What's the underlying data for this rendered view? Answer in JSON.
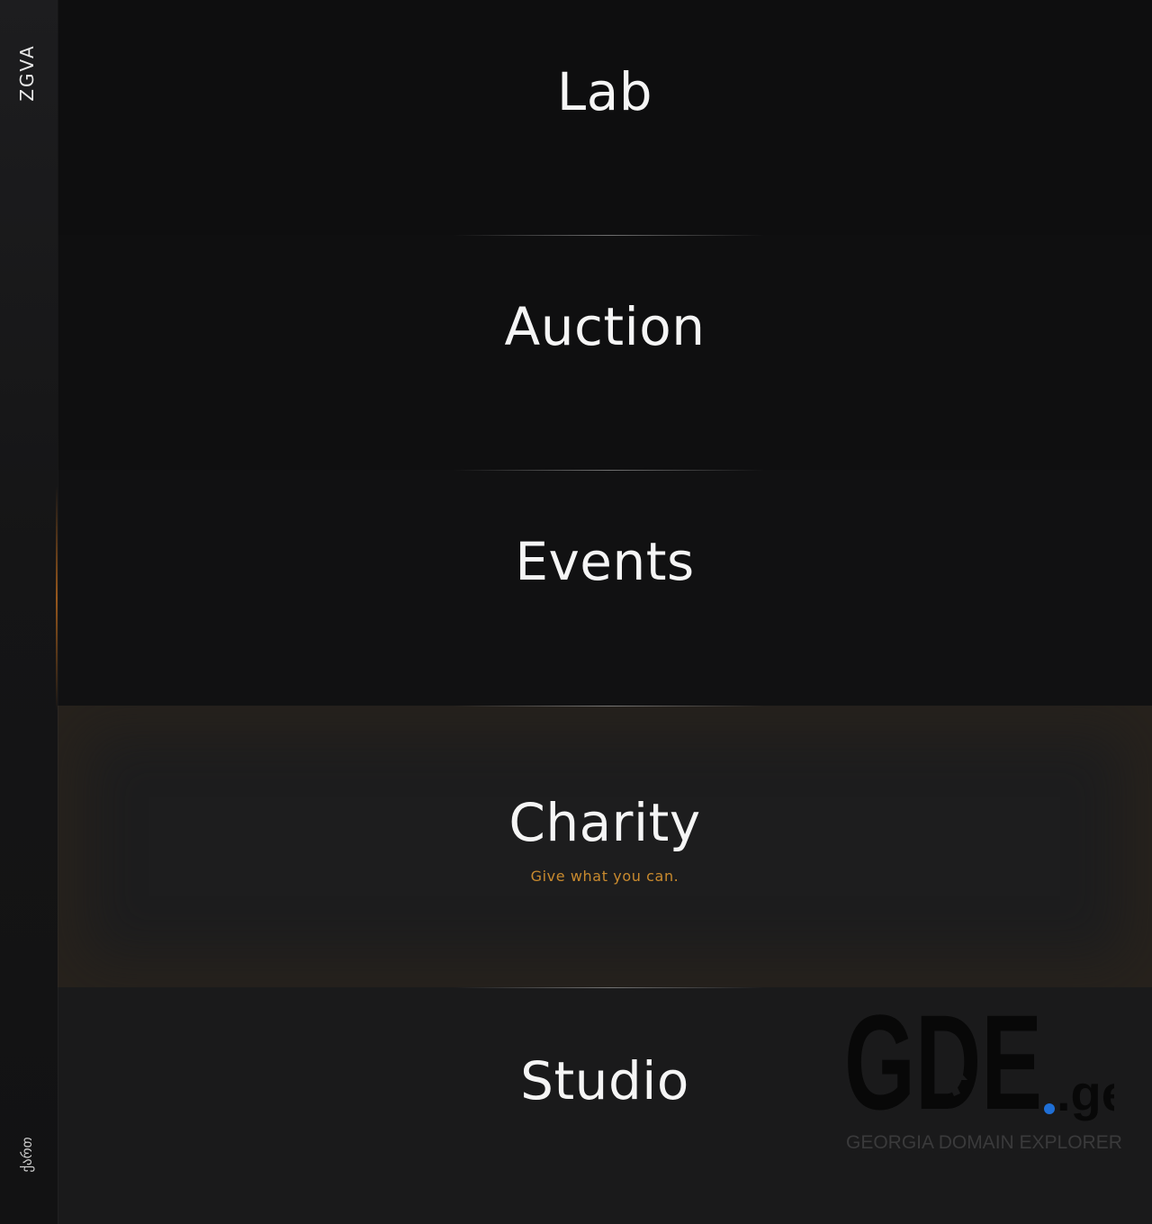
{
  "sidebar": {
    "brand": "ZGVA",
    "lang": "ქართ"
  },
  "sections": [
    {
      "title": "Lab",
      "subtitle": ""
    },
    {
      "title": "Auction",
      "subtitle": ""
    },
    {
      "title": "Events",
      "subtitle": ""
    },
    {
      "title": "Charity",
      "subtitle": "Give what you can."
    },
    {
      "title": "Studio",
      "subtitle": ""
    }
  ],
  "active_section": "Charity",
  "watermark": {
    "logo_text": "GDE",
    "logo_suffix": ".ge",
    "caption": "GEORGIA DOMAIN EXPLORER"
  },
  "colors": {
    "accent": "#c98a2e",
    "background": "#0f0f10",
    "sidebar": "#1a1a1b",
    "active_section_bg": "#1d1d1e",
    "watermark_dot": "#1f6fd6"
  }
}
